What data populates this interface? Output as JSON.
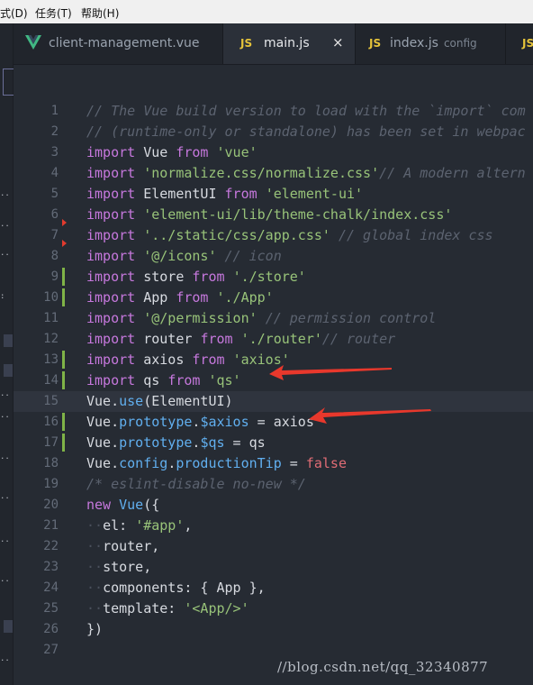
{
  "menu": [
    {
      "label": "式(D)"
    },
    {
      "label": "任务(T)"
    },
    {
      "label": "帮助(H)"
    }
  ],
  "tabs": [
    {
      "label": "client-management.vue",
      "icon": "vue-logo-icon",
      "active": false
    },
    {
      "label": "main.js",
      "badge": "JS",
      "active": true,
      "close": "×"
    },
    {
      "label": "index.js",
      "sub": "config",
      "badge": "JS",
      "active": false
    },
    {
      "label": "",
      "badge": "JS",
      "active": false
    }
  ],
  "colors": {
    "keyword": "#c678dd",
    "string": "#98c379",
    "comment": "#5c6370",
    "property": "#61afef",
    "boolean": "#e06c75",
    "gutter_added": "#7fb347",
    "arrow": "#e8382c"
  },
  "editor": {
    "lines": [
      {
        "num": "1",
        "parts": [
          [
            "c",
            "// The Vue build version to load with the `import` com"
          ]
        ]
      },
      {
        "num": "2",
        "parts": [
          [
            "c",
            "// (runtime-only or standalone) has been set in webpac"
          ]
        ]
      },
      {
        "num": "3",
        "parts": [
          [
            "k",
            "import"
          ],
          [
            "t",
            " Vue "
          ],
          [
            "k",
            "from"
          ],
          [
            "t",
            " "
          ],
          [
            "s",
            "'vue'"
          ]
        ]
      },
      {
        "num": "4",
        "parts": [
          [
            "k",
            "import"
          ],
          [
            "t",
            " "
          ],
          [
            "s",
            "'normalize.css/normalize.css'"
          ],
          [
            "c",
            "// A modern altern"
          ]
        ]
      },
      {
        "num": "5",
        "parts": [
          [
            "k",
            "import"
          ],
          [
            "t",
            " ElementUI "
          ],
          [
            "k",
            "from"
          ],
          [
            "t",
            " "
          ],
          [
            "s",
            "'element-ui'"
          ]
        ]
      },
      {
        "num": "6",
        "parts": [
          [
            "k",
            "import"
          ],
          [
            "t",
            " "
          ],
          [
            "s",
            "'element-ui/lib/theme-chalk/index.css'"
          ]
        ]
      },
      {
        "num": "7",
        "parts": [
          [
            "k",
            "import"
          ],
          [
            "t",
            " "
          ],
          [
            "s",
            "'../static/css/app.css'"
          ],
          [
            "t",
            " "
          ],
          [
            "c",
            "// global index css"
          ]
        ]
      },
      {
        "num": "8",
        "parts": [
          [
            "k",
            "import"
          ],
          [
            "t",
            " "
          ],
          [
            "s",
            "'@/icons'"
          ],
          [
            "t",
            " "
          ],
          [
            "c",
            "// icon"
          ]
        ]
      },
      {
        "num": "9",
        "parts": [
          [
            "k",
            "import"
          ],
          [
            "t",
            " store "
          ],
          [
            "k",
            "from"
          ],
          [
            "t",
            " "
          ],
          [
            "s",
            "'./store'"
          ]
        ]
      },
      {
        "num": "10",
        "parts": [
          [
            "k",
            "import"
          ],
          [
            "t",
            " App "
          ],
          [
            "k",
            "from"
          ],
          [
            "t",
            " "
          ],
          [
            "s",
            "'./App'"
          ]
        ]
      },
      {
        "num": "11",
        "parts": [
          [
            "k",
            "import"
          ],
          [
            "t",
            " "
          ],
          [
            "s",
            "'@/permission'"
          ],
          [
            "t",
            " "
          ],
          [
            "c",
            "// permission control"
          ]
        ]
      },
      {
        "num": "12",
        "parts": [
          [
            "k",
            "import"
          ],
          [
            "t",
            " router "
          ],
          [
            "k",
            "from"
          ],
          [
            "t",
            " "
          ],
          [
            "s",
            "'./router'"
          ],
          [
            "c",
            "// router"
          ]
        ]
      },
      {
        "num": "13",
        "parts": [
          [
            "k",
            "import"
          ],
          [
            "t",
            " axios "
          ],
          [
            "k",
            "from"
          ],
          [
            "t",
            " "
          ],
          [
            "s",
            "'axios'"
          ]
        ]
      },
      {
        "num": "14",
        "parts": [
          [
            "k",
            "import"
          ],
          [
            "t",
            " qs "
          ],
          [
            "k",
            "from"
          ],
          [
            "t",
            " "
          ],
          [
            "s",
            "'qs'"
          ]
        ]
      },
      {
        "num": "15",
        "parts": [
          [
            "t",
            "Vue."
          ],
          [
            "p",
            "use"
          ],
          [
            "t",
            "("
          ],
          [
            "t",
            "ElementUI"
          ],
          [
            "t",
            ")"
          ]
        ]
      },
      {
        "num": "16",
        "parts": [
          [
            "t",
            "Vue."
          ],
          [
            "p",
            "prototype"
          ],
          [
            "t",
            "."
          ],
          [
            "p",
            "$axios"
          ],
          [
            "t",
            " = axios"
          ]
        ]
      },
      {
        "num": "17",
        "parts": [
          [
            "t",
            "Vue."
          ],
          [
            "p",
            "prototype"
          ],
          [
            "t",
            "."
          ],
          [
            "p",
            "$qs"
          ],
          [
            "t",
            " = qs"
          ]
        ]
      },
      {
        "num": "18",
        "parts": [
          [
            "t",
            "Vue."
          ],
          [
            "p",
            "config"
          ],
          [
            "t",
            "."
          ],
          [
            "p",
            "productionTip"
          ],
          [
            "t",
            " = "
          ],
          [
            "b",
            "false"
          ]
        ]
      },
      {
        "num": "19",
        "parts": [
          [
            "c",
            "/* eslint-disable no-new */"
          ]
        ]
      },
      {
        "num": "20",
        "parts": [
          [
            "k",
            "new"
          ],
          [
            "t",
            " "
          ],
          [
            "p",
            "Vue"
          ],
          [
            "t",
            "({"
          ]
        ]
      },
      {
        "num": "21",
        "parts": [
          [
            "i",
            "··"
          ],
          [
            "t",
            "el: "
          ],
          [
            "s",
            "'#app'"
          ],
          [
            "t",
            ","
          ]
        ]
      },
      {
        "num": "22",
        "parts": [
          [
            "i",
            "··"
          ],
          [
            "t",
            "router,"
          ]
        ]
      },
      {
        "num": "23",
        "parts": [
          [
            "i",
            "··"
          ],
          [
            "t",
            "store,"
          ]
        ]
      },
      {
        "num": "24",
        "parts": [
          [
            "i",
            "··"
          ],
          [
            "t",
            "components: { App },"
          ]
        ]
      },
      {
        "num": "25",
        "parts": [
          [
            "i",
            "··"
          ],
          [
            "t",
            "template: "
          ],
          [
            "s",
            "'<App/>'"
          ]
        ]
      },
      {
        "num": "26",
        "parts": [
          [
            "t",
            "})"
          ]
        ]
      },
      {
        "num": "27",
        "parts": []
      }
    ]
  },
  "watermark": "//blog.csdn.net/qq_32340877"
}
